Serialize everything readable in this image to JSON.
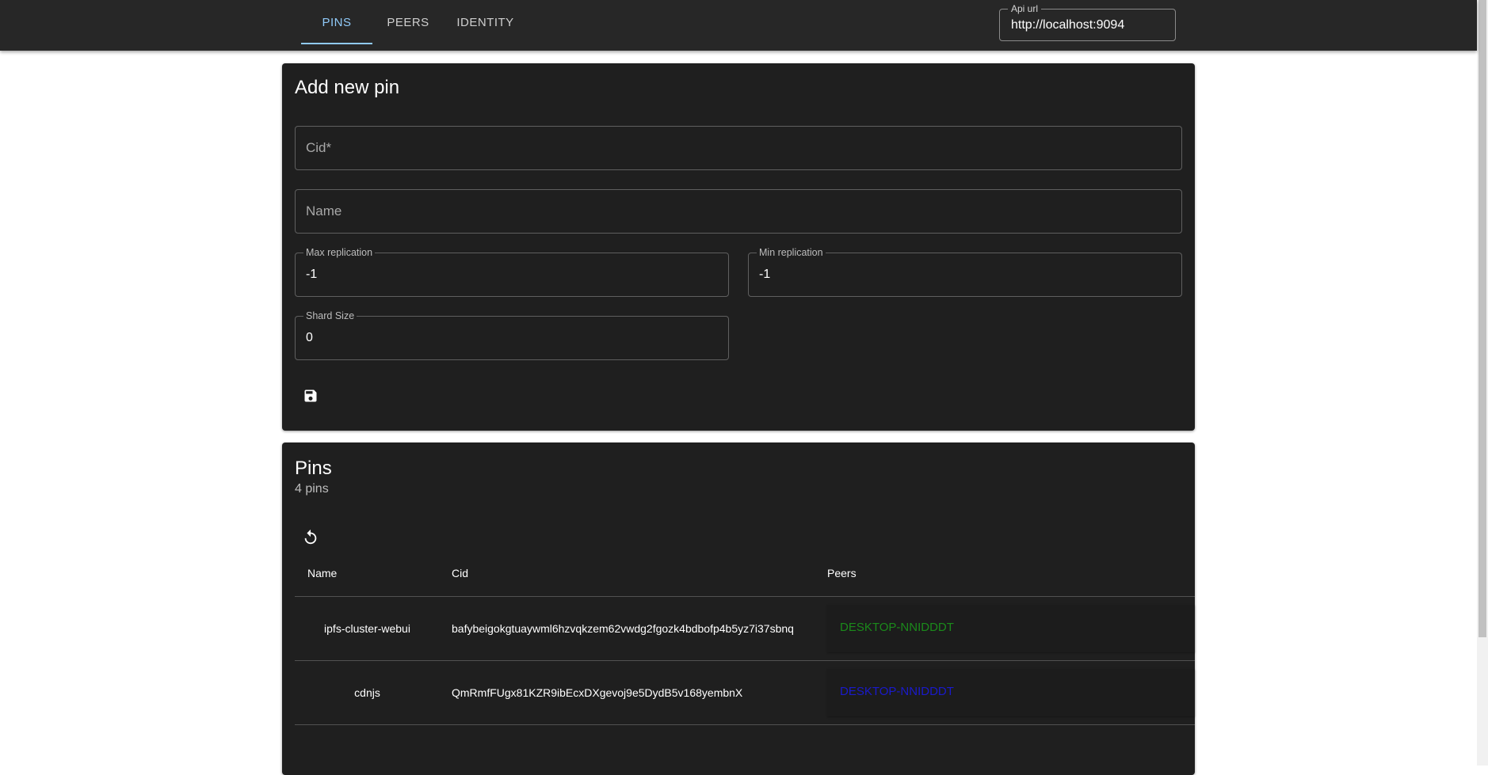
{
  "nav": {
    "tabs": [
      {
        "label": "PINS",
        "active": true
      },
      {
        "label": "PEERS",
        "active": false
      },
      {
        "label": "IDENTITY",
        "active": false
      }
    ],
    "api_url": {
      "label": "Api url",
      "value": "http://localhost:9094"
    }
  },
  "add_pin": {
    "title": "Add new pin",
    "cid_placeholder": "Cid*",
    "name_placeholder": "Name",
    "max_replication": {
      "label": "Max replication",
      "value": "-1"
    },
    "min_replication": {
      "label": "Min replication",
      "value": "-1"
    },
    "shard_size": {
      "label": "Shard Size",
      "value": "0"
    },
    "save_icon": "save-icon"
  },
  "pins": {
    "title": "Pins",
    "count_text": "4 pins",
    "refresh_icon": "refresh-icon",
    "columns": {
      "name": "Name",
      "cid": "Cid",
      "peers": "Peers"
    },
    "rows": [
      {
        "name": "ipfs-cluster-webui",
        "cid": "bafybeigokgtuaywml6hzvqkzem62vwdg2fgozk4bdbofp4b5yz7i37sbnq",
        "peer": "DESKTOP-NNIDDDT",
        "peer_color": "#1b8a1b"
      },
      {
        "name": "cdnjs",
        "cid": "QmRmfFUgx81KZR9ibEcxDXgevoj9e5DydB5v168yembnX",
        "peer": "DESKTOP-NNIDDDT",
        "peer_color": "#1a1acc"
      }
    ]
  },
  "colors": {
    "accent": "#90caf9",
    "appbar": "#272727",
    "card": "#1f1f1f"
  }
}
